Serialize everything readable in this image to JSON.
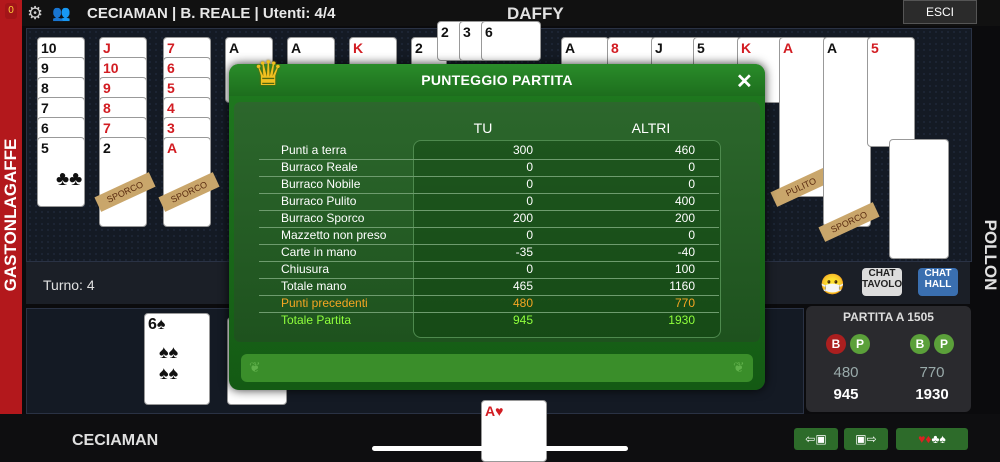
{
  "header": {
    "room_info": "CECIAMAN | B. REALE | Utenti: 4/4",
    "top_player": "DAFFY",
    "exit_label": "ESCI",
    "left_badge": "0"
  },
  "players": {
    "left": "GASTONLAGAFFE",
    "right": "POLLON",
    "bottom": "CECIAMAN"
  },
  "table": {
    "sporco_label": "SPORCO",
    "pulito_label": "PULITO",
    "turn": "Turno: 4",
    "chat_table": "CHAT TAVOLO",
    "chat_hall": "CHAT HALL",
    "visible_card_ranks": [
      "10",
      "9",
      "8",
      "7",
      "6",
      "5",
      "J",
      "10",
      "9",
      "8",
      "7",
      "2",
      "7",
      "6",
      "5",
      "4",
      "3",
      "A",
      "A",
      "K",
      "2",
      "3",
      "6",
      "A",
      "8",
      "J",
      "5",
      "K",
      "A",
      "A",
      "5"
    ]
  },
  "mini_score": {
    "title": "PARTITA A 1505",
    "b": "B",
    "p": "P",
    "team1_prev": "480",
    "team1_total": "945",
    "team2_prev": "770",
    "team2_total": "1930"
  },
  "modal": {
    "title": "PUNTEGGIO PARTITA",
    "close": "✕",
    "col_tu": "TU",
    "col_altri": "ALTRI",
    "rows": [
      {
        "label": "Punti a terra",
        "tu": "300",
        "altri": "460"
      },
      {
        "label": "Burraco Reale",
        "tu": "0",
        "altri": "0"
      },
      {
        "label": "Burraco Nobile",
        "tu": "0",
        "altri": "0"
      },
      {
        "label": "Burraco Pulito",
        "tu": "0",
        "altri": "400"
      },
      {
        "label": "Burraco Sporco",
        "tu": "200",
        "altri": "200"
      },
      {
        "label": "Mazzetto non preso",
        "tu": "0",
        "altri": "0"
      },
      {
        "label": "Carte in mano",
        "tu": "-35",
        "altri": "-40"
      },
      {
        "label": "Chiusura",
        "tu": "0",
        "altri": "100"
      },
      {
        "label": "Totale mano",
        "tu": "465",
        "altri": "1160"
      },
      {
        "label": "Punti precedenti",
        "tu": "480",
        "altri": "770"
      },
      {
        "label": "Totale Partita",
        "tu": "945",
        "altri": "1930"
      }
    ]
  },
  "icons": {
    "gear": "gear-icon",
    "people": "people-icon",
    "crown": "crown-icon",
    "close": "close-icon",
    "emoji": "emoji-icon"
  },
  "colors": {
    "felt_green": "#1f7a1f",
    "prev_points": "#f5a623",
    "total_points": "#8fff3c",
    "left_strip": "#b3181c"
  }
}
